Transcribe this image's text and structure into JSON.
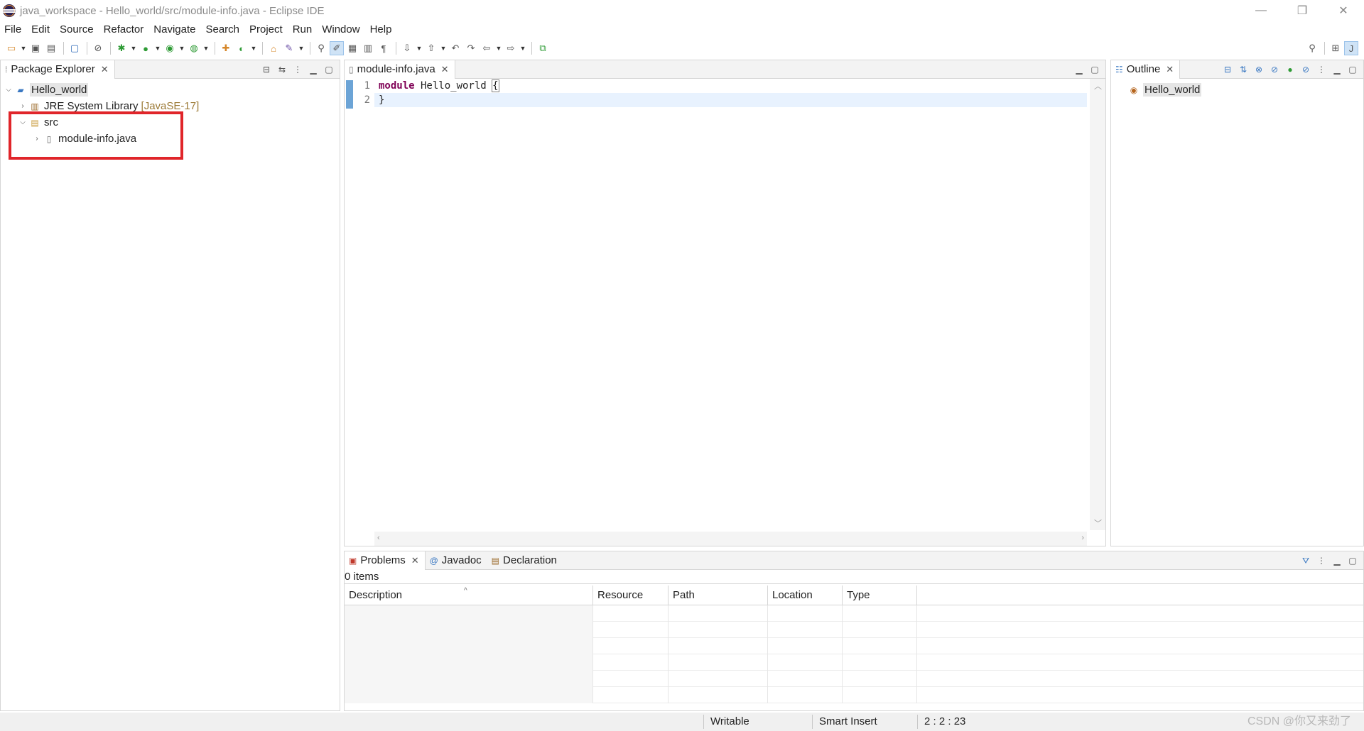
{
  "window": {
    "title": "java_workspace - Hello_world/src/module-info.java - Eclipse IDE",
    "controls": {
      "minimize": "—",
      "restore": "❐",
      "close": "✕"
    }
  },
  "menu": [
    "File",
    "Edit",
    "Source",
    "Refactor",
    "Navigate",
    "Search",
    "Project",
    "Run",
    "Window",
    "Help"
  ],
  "package_explorer": {
    "tab_label": "Package Explorer",
    "tree": {
      "project": "Hello_world",
      "jre_label": "JRE System Library",
      "jre_decor": "[JavaSE-17]",
      "src": "src",
      "file": "module-info.java"
    }
  },
  "editor": {
    "tab_label": "module-info.java",
    "line_numbers": [
      "1",
      "2"
    ],
    "line1_keyword": "module",
    "line1_name": " Hello_world ",
    "line1_brace": "{",
    "line2": "}"
  },
  "outline": {
    "tab_label": "Outline",
    "item": "Hello_world"
  },
  "bottom": {
    "tabs": {
      "problems": "Problems",
      "javadoc": "Javadoc",
      "declaration": "Declaration"
    },
    "items_count": "0 items",
    "columns": [
      "Description",
      "Resource",
      "Path",
      "Location",
      "Type"
    ]
  },
  "status": {
    "writable": "Writable",
    "insert_mode": "Smart Insert",
    "position": "2 : 2 : 23",
    "watermark": "CSDN @你又来劲了"
  },
  "colors": {
    "keyword": "#7f0055",
    "highlight_box": "#e0252a",
    "current_line": "#e8f2fe"
  }
}
